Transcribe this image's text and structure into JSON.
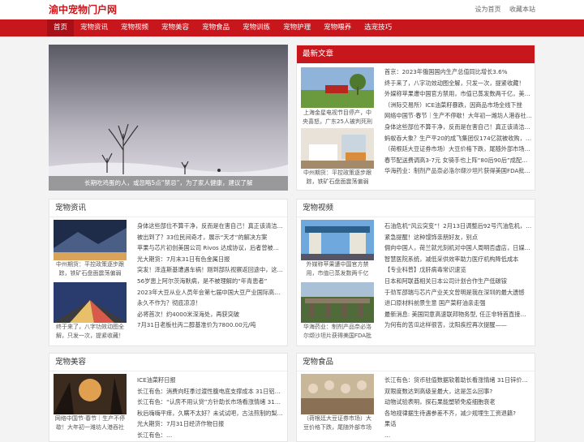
{
  "site": {
    "title": "渝中宠物门户网",
    "top_links": [
      "设为首页",
      "收藏本站"
    ]
  },
  "nav": [
    "首页",
    "宠物资讯",
    "宠物视频",
    "宠物美容",
    "宠物食品",
    "宠物训练",
    "宠物护理",
    "宠物喂养",
    "选宠技巧"
  ],
  "hero": {
    "caption": "长期吃鸡蛋的人，或忽略5点“禁忌”，为了家人健康，建议了解"
  },
  "latest": {
    "title": "最新文章",
    "thumbs": [
      "上海金星电视节目停产，中央喜怒，广东25人被判死刑",
      "中州期货：平控政策逐步跟踪，铁矿石盘面震荡偏弱"
    ],
    "items": [
      "首京：2023年俄国国内生产总值同比增长3.6%",
      "终于来了，八字功效动图全解，只发一次，提紧收藏！",
      "外媒称苹果遭中国官方禁用，市值已蒸发数两千亿，美…",
      "（洲际交易所）ICE油菜籽暴跌，因商品市场全线下挫",
      "网络中国节·春节｜生产不停歇！大年初一潍坊人港吞社…",
      "身体这些部位不算干净，反而是在害自己！真正该清洁…",
      "蚂蚁吞大象？生产平20的成飞集团仅174亿就被收购，主…",
      "（荷根廷大豆证券市场）大豆价格下跌，尾随外部市场…",
      "春节配送费调高3-7元 女骑手也上阵“80后90后”成配送主力",
      "华海药业：制剂产品奈必洛尔缬沙坦片获得美国FDA批…"
    ]
  },
  "sections": [
    {
      "title": "宠物资讯",
      "thumbs": [
        "中州期货：平控政策逐步跟踪，铁矿石盘面震荡偏弱",
        "终于来了，八字功效动图全解，只发一次，提紧收藏！"
      ],
      "items": [
        "身体这些部位不算干净，反而是在害自己！真正该清洁…",
        "被出到了？33位民间奇才，展示“天才”的解决方案",
        "苹果与芯片初创美国公司 Rivos 达成协议，后者曾被指控…",
        "光大期货：7月末31日有色金属日报",
        "突发！泽连斯基遭遇车祸！刚到部队视察返回途中，这…",
        "56岁患上阿尔茨海默病，是不被理解的“年青患者”",
        "2023年大豆从业人员年会第七届中国大豆产业国际高峰…",
        "永久不作为？彻底凉凉！",
        "必将首次！约4000米深海处，再获突破",
        "7月31日老板社丙二醇基准价为7800.00元/吨"
      ]
    },
    {
      "title": "宠物视频",
      "thumbs": [
        "外媒称苹果遭中国官方禁用，市值已蒸发数两千亿",
        "华海药业：制剂产品奈必洛尔缬沙坦片获得美国FDA批"
      ],
      "items": [
        "石油危机“风云突变”！2月13日调整后92号汽油危机，…",
        "紧急提醒！这种馒饰亲朋好友，别点",
        "佣向中国人，荷兰就光刻机对中国人周明否虚店，日媒…",
        "智慧医院系统，减低采供效率助力医疗机构降低成本",
        "【专业科普】戊肝病毒常识速览",
        "日本和阿联酋相关日本公司计划合作生产低碳铵",
        "于劲军邵瑞与芯片产业关文曾明是我在深圳的最大遗憾",
        "进口原材料前景生意 国产菜籽油亲走强",
        "最新消息: 美国同意高速联邦物务型, 任正非特首直接…",
        "为何有的苦瓜这样很苦，沈阳疾控再次提醒——"
      ]
    },
    {
      "title": "宠物美容",
      "thumbs": [
        "网络中国节·春节｜生产不停歇！大年初一潍坊人港吞社"
      ],
      "items": [
        "ICE油菜籽日报",
        "长江有色：消费向旺季过渡性腹电底支撑成本 31日铝价…",
        "长江有色：“认房不用认贷”方针助长市场看涨情绪 31日…",
        "秋后嗨嗨平痒，久瞒不太好？未试试吧，古法煎制的梨…",
        "光大期货：7月31日经济作物日报",
        "长江有色：…"
      ]
    },
    {
      "title": "宠物食品",
      "thumbs": [
        "（荷根廷大豆证券市场）大豆价格下跌，尾随外部市场"
      ],
      "items": [
        "长江有色：货币驻值数据软着助长看涨情绪 31日锌价或…",
        "双限度数达到高级呈最大，这是怎么回事?",
        "动物试验表明，探石果能塑轿免疫细胞衰老",
        "各地规律据生待遇参差不齐，减少规埋生工资退籍?",
        "果话",
        "…"
      ]
    }
  ]
}
